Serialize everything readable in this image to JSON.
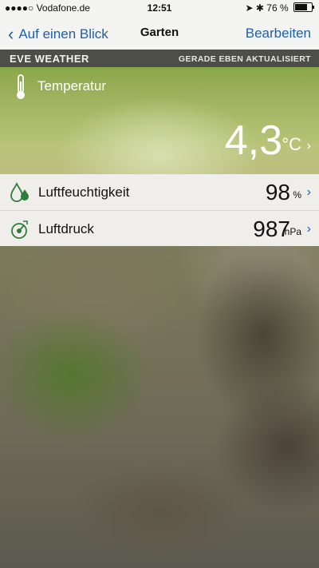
{
  "status_bar": {
    "carrier": "●●●●○ Vodafone.de",
    "time": "12:51",
    "battery": "76 %"
  },
  "nav": {
    "back_label": "Auf einen Blick",
    "title": "Garten",
    "edit_label": "Bearbeiten"
  },
  "section": {
    "name": "EVE WEATHER",
    "update_status": "GERADE EBEN AKTUALISIERT"
  },
  "temperature": {
    "label": "Temperatur",
    "value": "4,3",
    "unit": "°C",
    "icon": "thermometer-icon"
  },
  "rows": [
    {
      "label": "Luftfeuchtigkeit",
      "value": "98",
      "unit": "%",
      "icon": "humidity-drop-icon"
    },
    {
      "label": "Luftdruck",
      "value": "987",
      "unit": "hPa",
      "icon": "pressure-gauge-icon"
    }
  ],
  "colors": {
    "accent": "#1f5fa8",
    "icon_green": "#2e7d3a",
    "section_bar": "#4e4e48"
  }
}
